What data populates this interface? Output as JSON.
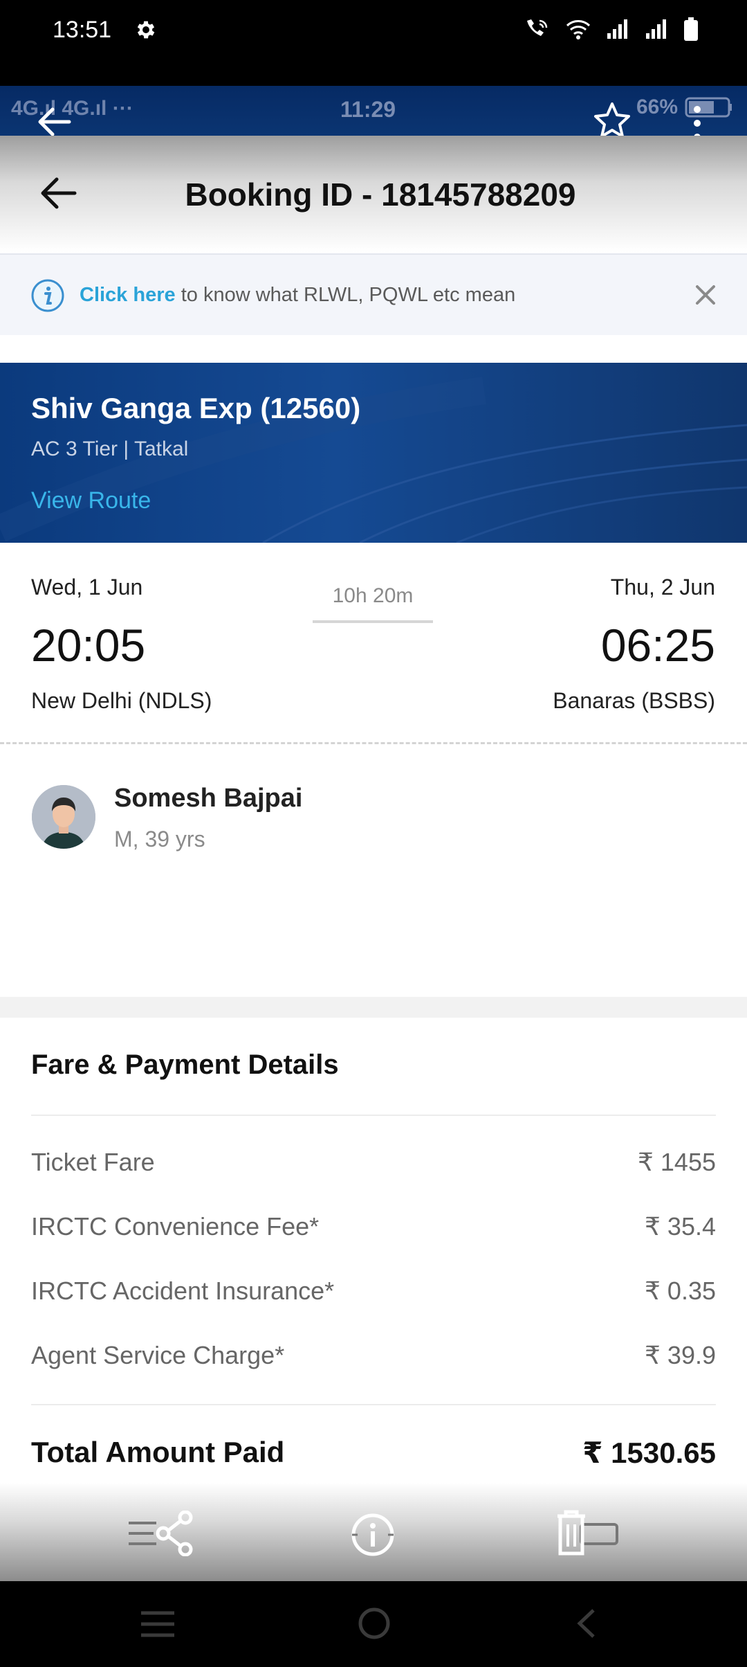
{
  "status_bar": {
    "time": "13:51",
    "icons": [
      "gear-icon",
      "wifi-calling-icon",
      "wifi-icon",
      "signal-icon",
      "signal-icon",
      "battery-icon"
    ]
  },
  "inner_status": {
    "left": "4G.ıl 4G.ıl ···",
    "time": "11:29",
    "right": "66%"
  },
  "header": {
    "title": "Booking ID - 18145788209"
  },
  "info_banner": {
    "link_text": "Click here",
    "text": " to know what RLWL, PQWL etc mean"
  },
  "train": {
    "name": "Shiv Ganga Exp (12560)",
    "class": "AC 3 Tier | Tatkal",
    "route_link": "View Route"
  },
  "journey": {
    "departure": {
      "date": "Wed, 1 Jun",
      "time": "20:05",
      "station": "New Delhi (NDLS)"
    },
    "duration": "10h 20m",
    "arrival": {
      "date": "Thu, 2 Jun",
      "time": "06:25",
      "station": "Banaras (BSBS)"
    }
  },
  "passenger": {
    "name": "Somesh Bajpai",
    "meta": "M, 39 yrs"
  },
  "fare": {
    "title": "Fare & Payment Details",
    "rows": [
      {
        "label": "Ticket Fare",
        "value": "₹ 1455"
      },
      {
        "label": "IRCTC Convenience Fee*",
        "value": "₹ 35.4"
      },
      {
        "label": "IRCTC Accident Insurance*",
        "value": "₹ 0.35"
      },
      {
        "label": "Agent Service Charge*",
        "value": "₹ 39.9"
      }
    ],
    "total_label": "Total Amount Paid",
    "total_value": "₹ 1530.65"
  },
  "colors": {
    "accent_link": "#2aa3d8",
    "train_card_bg": "#0b3a7d"
  }
}
